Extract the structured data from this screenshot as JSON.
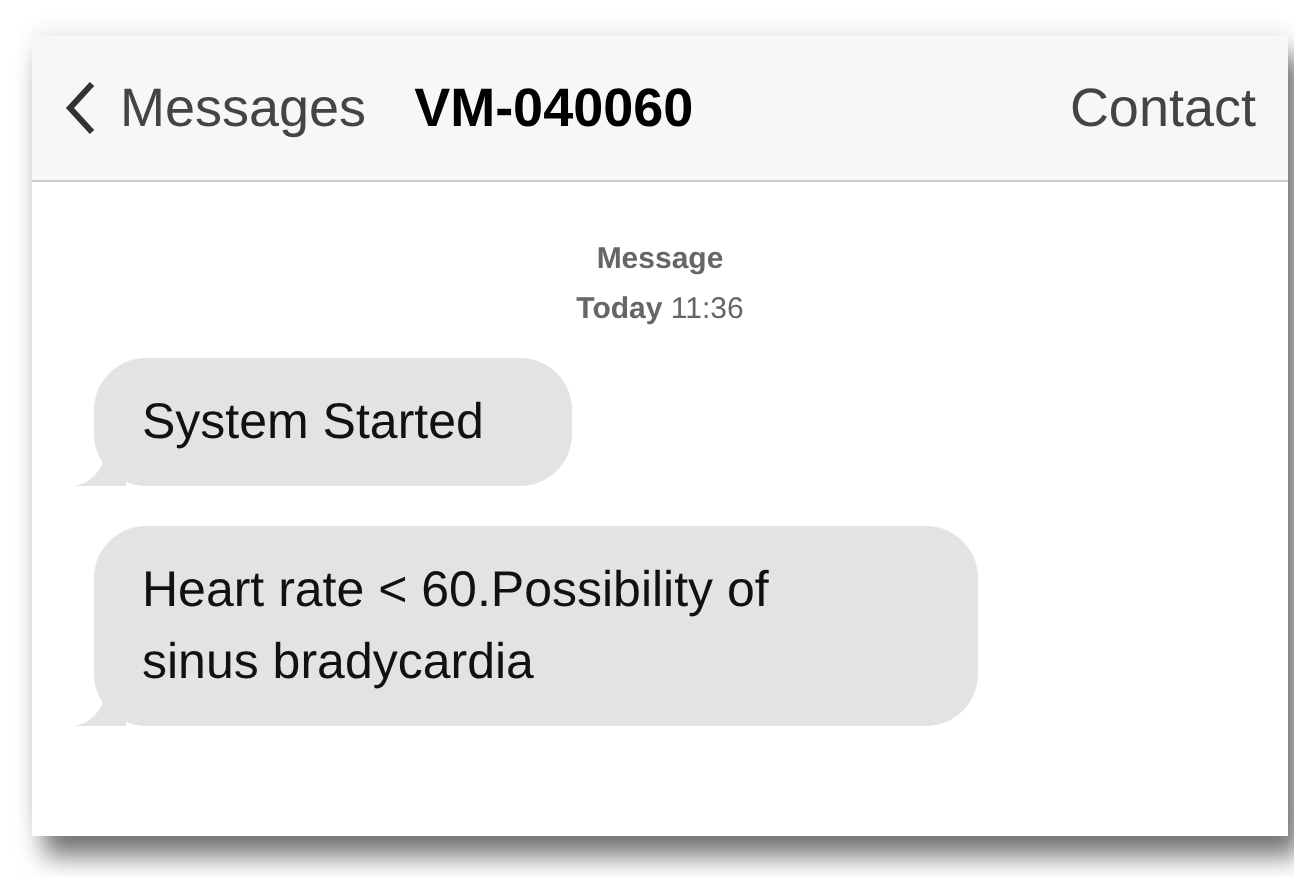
{
  "nav": {
    "back_label": "Messages",
    "title": "VM-040060",
    "action": "Contact"
  },
  "header": {
    "label": "Message",
    "day": "Today",
    "time": "11:36"
  },
  "messages": [
    {
      "text": "System Started"
    },
    {
      "text": "Heart rate < 60.Possibility of sinus bradycardia"
    }
  ]
}
